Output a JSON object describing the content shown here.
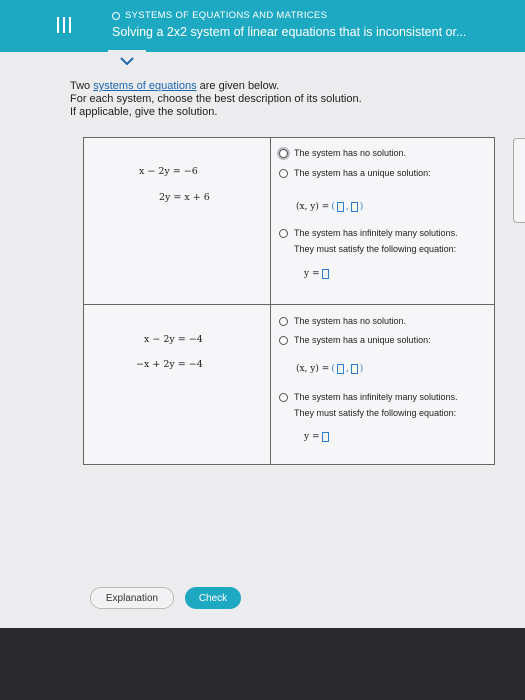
{
  "header": {
    "topic": "SYSTEMS OF EQUATIONS AND MATRICES",
    "title": "Solving a 2x2 system of linear equations that is inconsistent or..."
  },
  "intro": {
    "line1_pre": "Two ",
    "line1_link": "systems of equations",
    "line1_post": " are given below.",
    "line2": "For each system, choose the best description of its solution.",
    "line3": "If applicable, give the solution."
  },
  "system1": {
    "eq1": "x − 2y  =  −6",
    "eq2": "2y  =  x + 6"
  },
  "system2": {
    "eq1": "x − 2y  =  −4",
    "eq2": "−x + 2y  =  −4"
  },
  "options": {
    "no_solution": "The system has no solution.",
    "unique": "The system has a unique solution:",
    "infinite_1": "The system has infinitely many solutions.",
    "infinite_2": "They must satisfy the following equation:",
    "xy_label": "(x, y)  =",
    "y_label": "y ="
  },
  "buttons": {
    "explanation": "Explanation",
    "check": "Check"
  },
  "colors": {
    "header": "#1ea9c2",
    "link": "#1b67b0",
    "answer_box": "#2a7fd0"
  }
}
